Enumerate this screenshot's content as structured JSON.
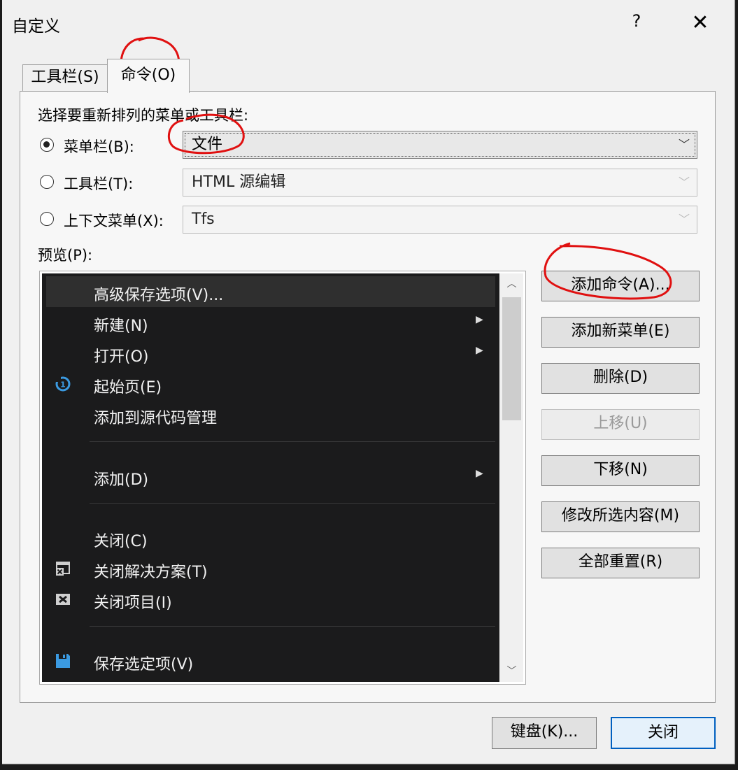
{
  "dialog": {
    "title": "自定义",
    "help": "?",
    "close_glyph": "✕"
  },
  "tabs": [
    {
      "label": "工具栏(S)"
    },
    {
      "label": "命令(O)"
    }
  ],
  "select_prompt": "选择要重新排列的菜单或工具栏:",
  "options": {
    "menubar": {
      "label": "菜单栏(B):",
      "value": "文件",
      "checked": true
    },
    "toolbar": {
      "label": "工具栏(T):",
      "value": "HTML 源编辑",
      "checked": false
    },
    "context": {
      "label": "上下文菜单(X):",
      "value": "Tfs",
      "checked": false
    }
  },
  "preview_label": "预览(P):",
  "menu_items": [
    {
      "label": "高级保存选项(V)...",
      "icon": "none",
      "submenu": false,
      "highlighted": true
    },
    {
      "label": "新建(N)",
      "icon": "none",
      "submenu": true
    },
    {
      "label": "打开(O)",
      "icon": "none",
      "submenu": true
    },
    {
      "label": "起始页(E)",
      "icon": "start-page-icon",
      "submenu": false
    },
    {
      "label": "添加到源代码管理",
      "icon": "none",
      "submenu": false
    },
    {
      "label": "添加(D)",
      "icon": "none",
      "submenu": true
    },
    {
      "label": "关闭(C)",
      "icon": "none",
      "submenu": false
    },
    {
      "label": "关闭解决方案(T)",
      "icon": "close-solution-icon",
      "submenu": false
    },
    {
      "label": "关闭项目(I)",
      "icon": "close-project-icon",
      "submenu": false
    },
    {
      "label": "保存选定项(V)",
      "icon": "save-icon",
      "submenu": false
    }
  ],
  "buttons": {
    "add_command": "添加命令(A)...",
    "add_menu": "添加新菜单(E)",
    "delete": "删除(D)",
    "move_up": "上移(U)",
    "move_down": "下移(N)",
    "modify": "修改所选内容(M)",
    "reset_all": "全部重置(R)"
  },
  "footer": {
    "keyboard": "键盘(K)...",
    "close": "关闭"
  },
  "colors": {
    "menu_bg": "#1b1b1c",
    "icon_blue": "#3b9ae1",
    "annotation_red": "#e01010",
    "default_button_border": "#0060c0"
  }
}
